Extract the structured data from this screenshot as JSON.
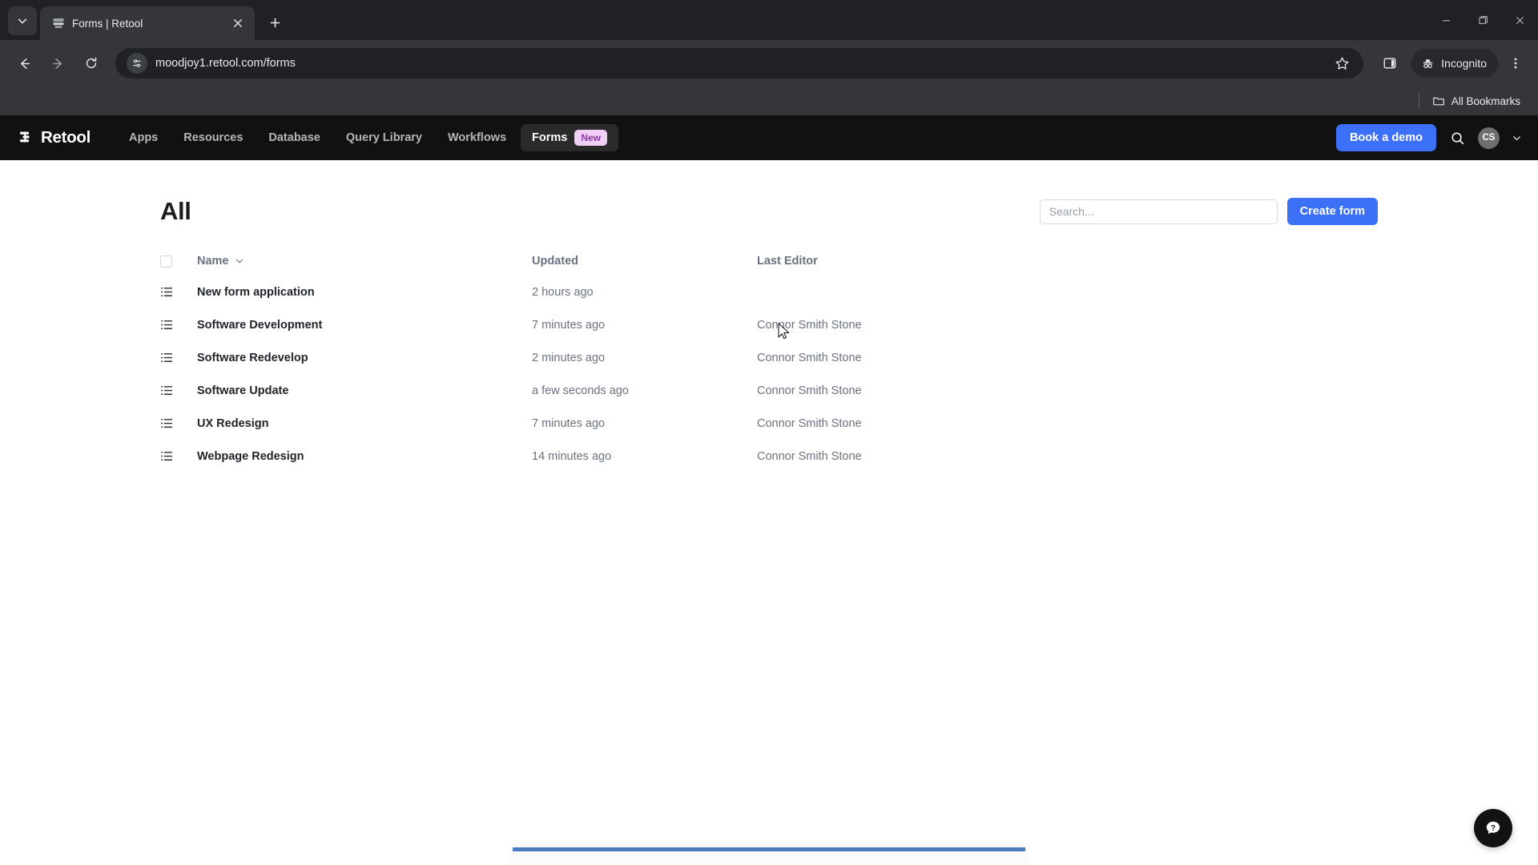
{
  "browser": {
    "tab": {
      "title": "Forms | Retool",
      "favicon_icon": "browser-page-favicon",
      "close_icon": "close-icon"
    },
    "tab_search_icon": "chevron-down-icon",
    "new_tab_icon": "plus-icon",
    "window_controls": {
      "minimize_icon": "minimize-icon",
      "maximize_icon": "maximize-icon",
      "close_icon": "window-close-icon"
    },
    "toolbar": {
      "back_icon": "back-arrow-icon",
      "forward_icon": "forward-arrow-icon",
      "reload_icon": "reload-icon",
      "site_settings_icon": "tune-settings-icon",
      "url": "moodjoy1.retool.com/forms",
      "bookmark_icon": "star-icon",
      "side_panel_icon": "side-panel-icon",
      "incognito_label": "Incognito",
      "incognito_icon": "incognito-hat-icon",
      "menu_icon": "three-dot-menu-icon"
    },
    "bookmarks": {
      "folder_icon": "folder-icon",
      "label": "All Bookmarks"
    }
  },
  "navbar": {
    "logo_text": "Retool",
    "logo_icon": "retool-logo-icon",
    "links": [
      {
        "label": "Apps",
        "active": false
      },
      {
        "label": "Resources",
        "active": false
      },
      {
        "label": "Database",
        "active": false
      },
      {
        "label": "Query Library",
        "active": false
      },
      {
        "label": "Workflows",
        "active": false
      }
    ],
    "active_link": {
      "label": "Forms",
      "badge": "New"
    },
    "book_demo_label": "Book a demo",
    "search_icon": "search-icon",
    "avatar_initials": "CS",
    "avatar_caret_icon": "chevron-down-icon"
  },
  "page": {
    "title": "All",
    "search_placeholder": "Search...",
    "search_value": "",
    "create_button_label": "Create form"
  },
  "table": {
    "select_all_checked": false,
    "columns": {
      "name": "Name",
      "name_sort_icon": "chevron-down-icon",
      "updated": "Updated",
      "last_editor": "Last Editor"
    },
    "rows": [
      {
        "icon": "list-icon",
        "name": "New form application",
        "updated": "2 hours ago",
        "last_editor": ""
      },
      {
        "icon": "list-icon",
        "name": "Software Development",
        "updated": "7 minutes ago",
        "last_editor": "Connor Smith Stone"
      },
      {
        "icon": "list-icon",
        "name": "Software Redevelop",
        "updated": "2 minutes ago",
        "last_editor": "Connor Smith Stone"
      },
      {
        "icon": "list-icon",
        "name": "Software Update",
        "updated": "a few seconds ago",
        "last_editor": "Connor Smith Stone"
      },
      {
        "icon": "list-icon",
        "name": "UX Redesign",
        "updated": "7 minutes ago",
        "last_editor": "Connor Smith Stone"
      },
      {
        "icon": "list-icon",
        "name": "Webpage Redesign",
        "updated": "14 minutes ago",
        "last_editor": "Connor Smith Stone"
      }
    ]
  },
  "help": {
    "icon": "question-mark-chat-icon"
  },
  "colors": {
    "accent_blue": "#3c70f6",
    "navbar_bg": "#111111",
    "badge_bg": "#f0d0f5",
    "badge_text": "#8b3aa8",
    "bottom_panel_blue": "#4a7dc0"
  }
}
